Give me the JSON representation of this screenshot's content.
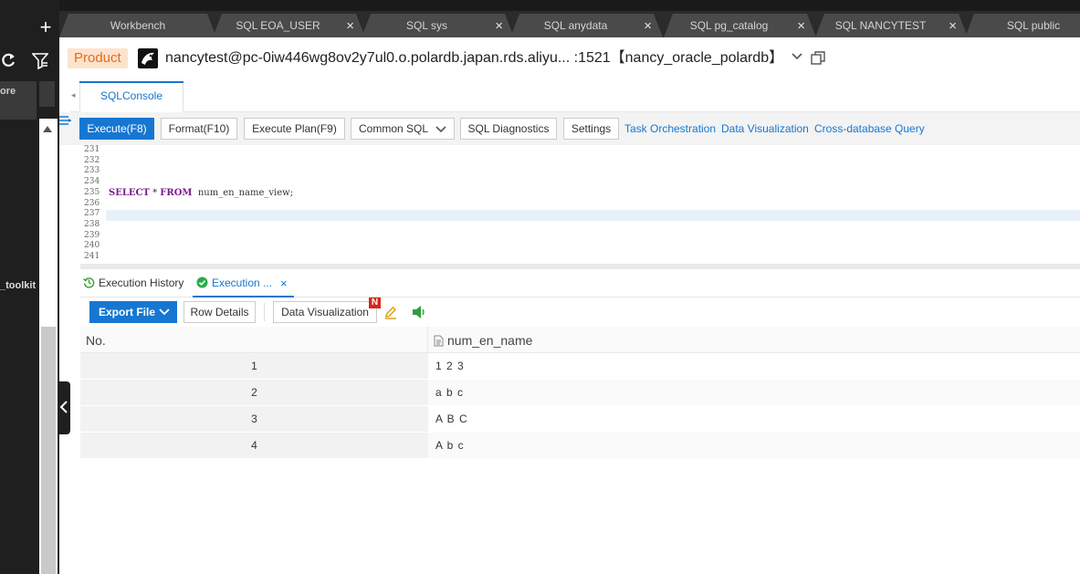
{
  "sidebar": {
    "add_label": "+",
    "more_label": "ore",
    "toolkit_label": "_toolkit"
  },
  "tabs": [
    {
      "label": "Workbench",
      "closable": false
    },
    {
      "label": "SQL EOA_USER",
      "closable": true
    },
    {
      "label": "SQL sys",
      "closable": true
    },
    {
      "label": "SQL anydata",
      "closable": true
    },
    {
      "label": "SQL pg_catalog",
      "closable": true
    },
    {
      "label": "SQL NANCYTEST",
      "closable": true
    },
    {
      "label": "SQL public",
      "closable": false
    }
  ],
  "connection": {
    "environment": "Product",
    "text": "nancytest@pc-0iw446wg8ov2y7ul0.o.polardb.japan.rds.aliyu... :1521【nancy_oracle_polardb】",
    "env_color": "#e86a17"
  },
  "console_tab": "SQLConsole",
  "toolbar": {
    "execute": "Execute(F8)",
    "format": "Format(F10)",
    "execute_plan": "Execute Plan(F9)",
    "common_sql": "Common SQL",
    "diagnostics": "SQL Diagnostics",
    "settings": "Settings",
    "links": [
      "Task Orchestration",
      "Data Visualization",
      "Cross-database Query"
    ],
    "accent": "#1677d2"
  },
  "editor": {
    "line_numbers": [
      "231",
      "232",
      "233",
      "234",
      "235",
      "236",
      "237",
      "238",
      "239",
      "240",
      "241"
    ],
    "code": {
      "keyword1": "SELECT",
      "star": "*",
      "keyword2": "FROM",
      "object": "num_en_name_view;"
    }
  },
  "result_tabs": {
    "history": "Execution History",
    "execution": "Execution ...",
    "close": "×"
  },
  "result_toolbar": {
    "export": "Export File",
    "row_details": "Row Details",
    "data_visualization": "Data Visualization",
    "new_badge": "N"
  },
  "grid": {
    "columns": [
      "No.",
      "num_en_name"
    ],
    "rows": [
      {
        "no": "1",
        "value": "1 2 3"
      },
      {
        "no": "2",
        "value": "a b c"
      },
      {
        "no": "3",
        "value": "A B C"
      },
      {
        "no": "4",
        "value": "A b c"
      }
    ]
  }
}
